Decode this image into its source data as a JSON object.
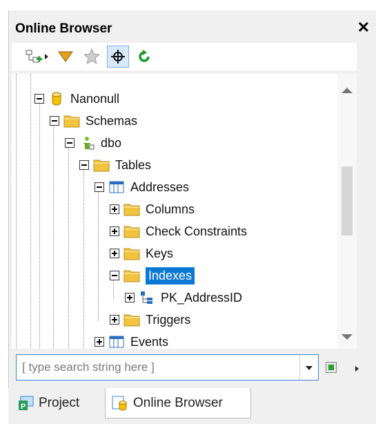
{
  "window": {
    "title": "Online Browser",
    "close_label": "✕"
  },
  "toolbar": {
    "buttons": [
      {
        "name": "add-connection-icon",
        "active": false
      },
      {
        "name": "more-arrow-icon",
        "active": false
      },
      {
        "name": "filter-icon",
        "active": false
      },
      {
        "name": "favorites-star-icon",
        "active": false
      },
      {
        "name": "locate-crosshair-icon",
        "active": true
      },
      {
        "name": "refresh-icon",
        "active": false
      }
    ]
  },
  "tree": {
    "items": [
      {
        "label": "Nanonull",
        "icon": "database-icon",
        "expander": "minus",
        "selected": false
      },
      {
        "label": "Schemas",
        "icon": "folder-icon",
        "expander": "minus",
        "selected": false
      },
      {
        "label": "dbo",
        "icon": "schema-user-icon",
        "expander": "minus",
        "selected": false
      },
      {
        "label": "Tables",
        "icon": "folder-icon",
        "expander": "minus",
        "selected": false
      },
      {
        "label": "Addresses",
        "icon": "table-icon",
        "expander": "minus",
        "selected": false
      },
      {
        "label": "Columns",
        "icon": "folder-icon",
        "expander": "plus",
        "selected": false
      },
      {
        "label": "Check Constraints",
        "icon": "folder-icon",
        "expander": "plus",
        "selected": false
      },
      {
        "label": "Keys",
        "icon": "folder-icon",
        "expander": "plus",
        "selected": false
      },
      {
        "label": "Indexes",
        "icon": "folder-icon",
        "expander": "minus",
        "selected": true
      },
      {
        "label": "PK_AddressID",
        "icon": "index-icon",
        "expander": "plus",
        "selected": false
      },
      {
        "label": "Triggers",
        "icon": "folder-icon",
        "expander": "plus",
        "selected": false
      },
      {
        "label": "Events",
        "icon": "table-icon",
        "expander": "plus",
        "selected": false
      }
    ]
  },
  "search": {
    "placeholder": "[ type search string here ]",
    "value": ""
  },
  "tabs": [
    {
      "label": "Project",
      "active": false
    },
    {
      "label": "Online Browser",
      "active": true
    }
  ],
  "colors": {
    "selection": "#0b78d6",
    "folder": "#f2c43d",
    "accent_blue": "#3b83d6"
  }
}
